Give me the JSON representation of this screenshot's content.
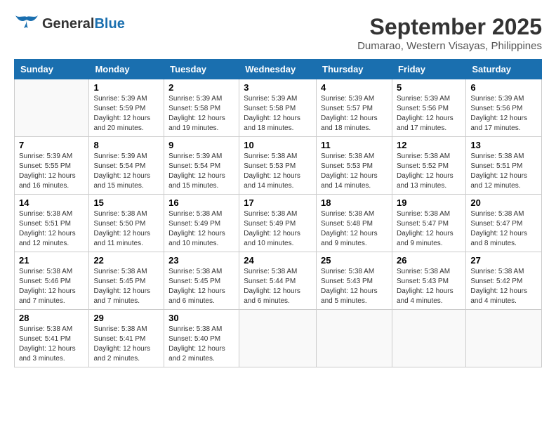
{
  "header": {
    "logo_line1": "General",
    "logo_line2": "Blue",
    "month": "September 2025",
    "location": "Dumarao, Western Visayas, Philippines"
  },
  "weekdays": [
    "Sunday",
    "Monday",
    "Tuesday",
    "Wednesday",
    "Thursday",
    "Friday",
    "Saturday"
  ],
  "weeks": [
    [
      {
        "day": "",
        "info": ""
      },
      {
        "day": "1",
        "info": "Sunrise: 5:39 AM\nSunset: 5:59 PM\nDaylight: 12 hours\nand 20 minutes."
      },
      {
        "day": "2",
        "info": "Sunrise: 5:39 AM\nSunset: 5:58 PM\nDaylight: 12 hours\nand 19 minutes."
      },
      {
        "day": "3",
        "info": "Sunrise: 5:39 AM\nSunset: 5:58 PM\nDaylight: 12 hours\nand 18 minutes."
      },
      {
        "day": "4",
        "info": "Sunrise: 5:39 AM\nSunset: 5:57 PM\nDaylight: 12 hours\nand 18 minutes."
      },
      {
        "day": "5",
        "info": "Sunrise: 5:39 AM\nSunset: 5:56 PM\nDaylight: 12 hours\nand 17 minutes."
      },
      {
        "day": "6",
        "info": "Sunrise: 5:39 AM\nSunset: 5:56 PM\nDaylight: 12 hours\nand 17 minutes."
      }
    ],
    [
      {
        "day": "7",
        "info": "Sunrise: 5:39 AM\nSunset: 5:55 PM\nDaylight: 12 hours\nand 16 minutes."
      },
      {
        "day": "8",
        "info": "Sunrise: 5:39 AM\nSunset: 5:54 PM\nDaylight: 12 hours\nand 15 minutes."
      },
      {
        "day": "9",
        "info": "Sunrise: 5:39 AM\nSunset: 5:54 PM\nDaylight: 12 hours\nand 15 minutes."
      },
      {
        "day": "10",
        "info": "Sunrise: 5:38 AM\nSunset: 5:53 PM\nDaylight: 12 hours\nand 14 minutes."
      },
      {
        "day": "11",
        "info": "Sunrise: 5:38 AM\nSunset: 5:53 PM\nDaylight: 12 hours\nand 14 minutes."
      },
      {
        "day": "12",
        "info": "Sunrise: 5:38 AM\nSunset: 5:52 PM\nDaylight: 12 hours\nand 13 minutes."
      },
      {
        "day": "13",
        "info": "Sunrise: 5:38 AM\nSunset: 5:51 PM\nDaylight: 12 hours\nand 12 minutes."
      }
    ],
    [
      {
        "day": "14",
        "info": "Sunrise: 5:38 AM\nSunset: 5:51 PM\nDaylight: 12 hours\nand 12 minutes."
      },
      {
        "day": "15",
        "info": "Sunrise: 5:38 AM\nSunset: 5:50 PM\nDaylight: 12 hours\nand 11 minutes."
      },
      {
        "day": "16",
        "info": "Sunrise: 5:38 AM\nSunset: 5:49 PM\nDaylight: 12 hours\nand 10 minutes."
      },
      {
        "day": "17",
        "info": "Sunrise: 5:38 AM\nSunset: 5:49 PM\nDaylight: 12 hours\nand 10 minutes."
      },
      {
        "day": "18",
        "info": "Sunrise: 5:38 AM\nSunset: 5:48 PM\nDaylight: 12 hours\nand 9 minutes."
      },
      {
        "day": "19",
        "info": "Sunrise: 5:38 AM\nSunset: 5:47 PM\nDaylight: 12 hours\nand 9 minutes."
      },
      {
        "day": "20",
        "info": "Sunrise: 5:38 AM\nSunset: 5:47 PM\nDaylight: 12 hours\nand 8 minutes."
      }
    ],
    [
      {
        "day": "21",
        "info": "Sunrise: 5:38 AM\nSunset: 5:46 PM\nDaylight: 12 hours\nand 7 minutes."
      },
      {
        "day": "22",
        "info": "Sunrise: 5:38 AM\nSunset: 5:45 PM\nDaylight: 12 hours\nand 7 minutes."
      },
      {
        "day": "23",
        "info": "Sunrise: 5:38 AM\nSunset: 5:45 PM\nDaylight: 12 hours\nand 6 minutes."
      },
      {
        "day": "24",
        "info": "Sunrise: 5:38 AM\nSunset: 5:44 PM\nDaylight: 12 hours\nand 6 minutes."
      },
      {
        "day": "25",
        "info": "Sunrise: 5:38 AM\nSunset: 5:43 PM\nDaylight: 12 hours\nand 5 minutes."
      },
      {
        "day": "26",
        "info": "Sunrise: 5:38 AM\nSunset: 5:43 PM\nDaylight: 12 hours\nand 4 minutes."
      },
      {
        "day": "27",
        "info": "Sunrise: 5:38 AM\nSunset: 5:42 PM\nDaylight: 12 hours\nand 4 minutes."
      }
    ],
    [
      {
        "day": "28",
        "info": "Sunrise: 5:38 AM\nSunset: 5:41 PM\nDaylight: 12 hours\nand 3 minutes."
      },
      {
        "day": "29",
        "info": "Sunrise: 5:38 AM\nSunset: 5:41 PM\nDaylight: 12 hours\nand 2 minutes."
      },
      {
        "day": "30",
        "info": "Sunrise: 5:38 AM\nSunset: 5:40 PM\nDaylight: 12 hours\nand 2 minutes."
      },
      {
        "day": "",
        "info": ""
      },
      {
        "day": "",
        "info": ""
      },
      {
        "day": "",
        "info": ""
      },
      {
        "day": "",
        "info": ""
      }
    ]
  ]
}
